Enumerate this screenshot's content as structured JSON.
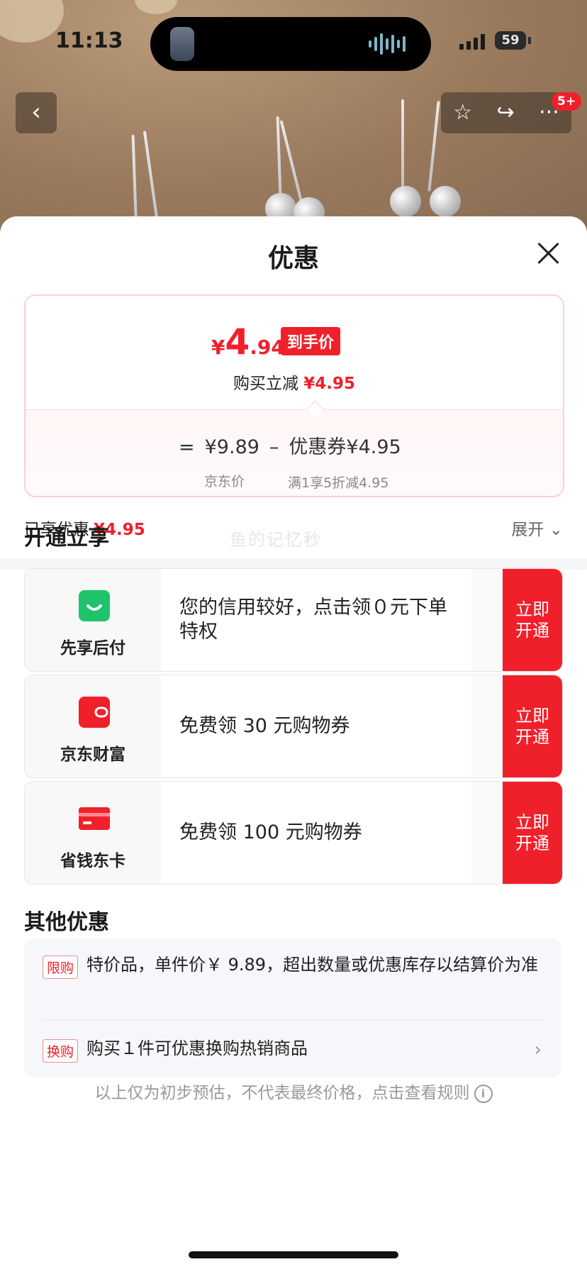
{
  "status": {
    "time": "11:13",
    "battery": "59"
  },
  "nav": {
    "back_icon": "‹",
    "star_icon": "☆",
    "share_icon": "↪",
    "more_icon": "···",
    "badge": "5+"
  },
  "sheet": {
    "title": "优惠",
    "price": {
      "currency": "¥",
      "final_int": "4",
      "final_dec": ".94",
      "final_tag": "到手价",
      "instant_label": "购买立减",
      "instant_value": "¥4.95",
      "equals": "=",
      "jd_price": "¥9.89",
      "minus": "–",
      "coupon_label": "优惠券¥4.95",
      "jd_price_label": "京东价",
      "coupon_desc": "满1享5折减4.95"
    },
    "enjoyed_label": "已享优惠",
    "enjoyed_value": "¥4.95",
    "expand_label": "展开 ⌄",
    "watermark": "鱼的记忆秒",
    "open_section": {
      "title": "开通立享",
      "items": [
        {
          "name": "先享后付",
          "text": "您的信用较好，点击领０元下单特权",
          "button": "立即开通",
          "icon_color": "#1ec36a"
        },
        {
          "name": "京东财富",
          "text": "免费领 30 元购物券",
          "button": "立即开通",
          "icon_color": "#f0202b"
        },
        {
          "name": "省钱东卡",
          "text": "免费领 100 元购物券",
          "button": "立即开通",
          "icon_color": "#f0202b"
        }
      ]
    },
    "other_section": {
      "title": "其他优惠",
      "items": [
        {
          "tag": "限购",
          "text": "特价品，单件价￥ 9.89，超出数量或优惠库存以结算价为准"
        },
        {
          "tag": "换购",
          "text": "购买１件可优惠换购热销商品"
        }
      ]
    },
    "footer": "以上仅为初步预估，不代表最终价格，点击查看规则"
  },
  "colors": {
    "accent": "#f0202b",
    "green": "#1ec36a"
  }
}
